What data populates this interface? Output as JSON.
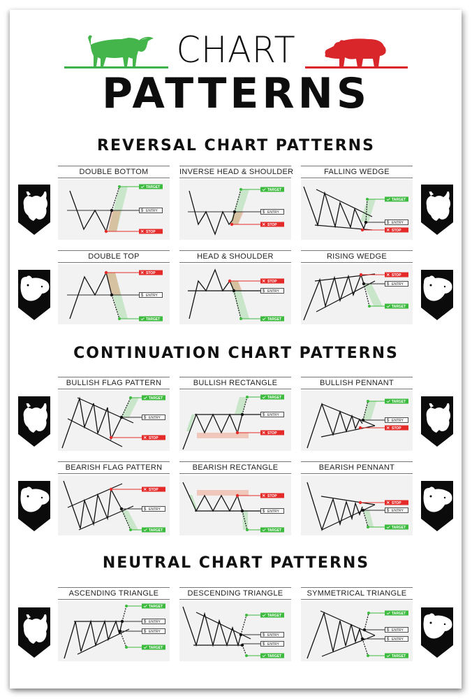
{
  "poster": {
    "title_line1": "CHART",
    "title_line2": "PATTERNS",
    "colors": {
      "bull": "#3db24a",
      "bear": "#d9262b",
      "target": "#3dbb3f",
      "stop": "#e52a2a",
      "panel": "#f1f2f1",
      "text": "#111111"
    }
  },
  "sections": [
    {
      "title": "REVERSAL CHART PATTERNS",
      "cards": [
        {
          "title": "DOUBLE BOTTOM"
        },
        {
          "title": "INVERSE HEAD & SHOULDER"
        },
        {
          "title": "FALLING WEDGE"
        },
        {
          "title": "DOUBLE TOP"
        },
        {
          "title": "HEAD & SHOULDER"
        },
        {
          "title": "RISING WEDGE"
        }
      ]
    },
    {
      "title": "CONTINUATION CHART PATTERNS",
      "cards": [
        {
          "title": "BULLISH FLAG PATTERN"
        },
        {
          "title": "BULLISH RECTANGLE"
        },
        {
          "title": "BULLISH PENNANT"
        },
        {
          "title": "BEARISH FLAG PATTERN"
        },
        {
          "title": "BEARISH RECTANGLE"
        },
        {
          "title": "BEARISH PENNANT"
        }
      ]
    },
    {
      "title": "NEUTRAL CHART PATTERNS",
      "cards": [
        {
          "title": "ASCENDING TRIANGLE"
        },
        {
          "title": "DESCENDING TRIANGLE"
        },
        {
          "title": "SYMMETRICAL TRIANGLE"
        }
      ]
    }
  ],
  "labels": {
    "target": "TARGET",
    "entry": "ENTRY",
    "stop": "STOP",
    "target_icon": "✓",
    "entry_icon": "$",
    "stop_icon": "✕"
  },
  "side_icons": {
    "row1": {
      "left": "bull",
      "right": "bull"
    },
    "row2": {
      "left": "bear",
      "right": "bear"
    },
    "row3": {
      "left": "bull",
      "right": "bull"
    },
    "row4": {
      "left": "bear",
      "right": "bear"
    },
    "row5": {
      "left": "bull",
      "right": "bear"
    }
  }
}
